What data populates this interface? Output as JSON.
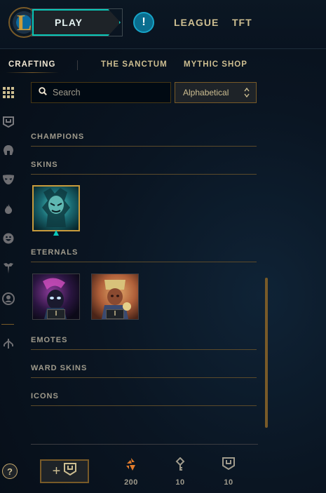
{
  "topbar": {
    "logo_letter": "L",
    "play_label": "PLAY",
    "alert_label": "!",
    "links": [
      "LEAGUE",
      "TFT"
    ]
  },
  "subnav": {
    "tabs": [
      "CRAFTING",
      "THE SANCTUM",
      "MYTHIC SHOP"
    ],
    "active": "CRAFTING"
  },
  "sidebar": {
    "icons": [
      "grid-icon",
      "chest-icon",
      "helmet-icon",
      "mask-icon",
      "flame-icon",
      "smiley-icon",
      "ward-icon",
      "profile-icon",
      "split-arrow-icon"
    ]
  },
  "search": {
    "placeholder": "Search"
  },
  "sort": {
    "selected": "Alphabetical"
  },
  "sections": {
    "champions": "CHAMPIONS",
    "skins": "SKINS",
    "eternals": "ETERNALS",
    "emotes": "EMOTES",
    "ward_skins": "WARD SKINS",
    "icons": "ICONS"
  },
  "eternals": [
    {
      "badge": "I"
    },
    {
      "badge": "I"
    }
  ],
  "footer": {
    "help_label": "?",
    "add_label": "+",
    "currencies": [
      {
        "icon": "orange-essence-icon",
        "value": "200"
      },
      {
        "icon": "key-icon",
        "value": "10"
      },
      {
        "icon": "chest-icon",
        "value": "10"
      }
    ]
  },
  "colors": {
    "gold": "#c89b3c",
    "teal": "#0ac8b9",
    "background": "#0a1522",
    "text": "#cdbe91"
  }
}
